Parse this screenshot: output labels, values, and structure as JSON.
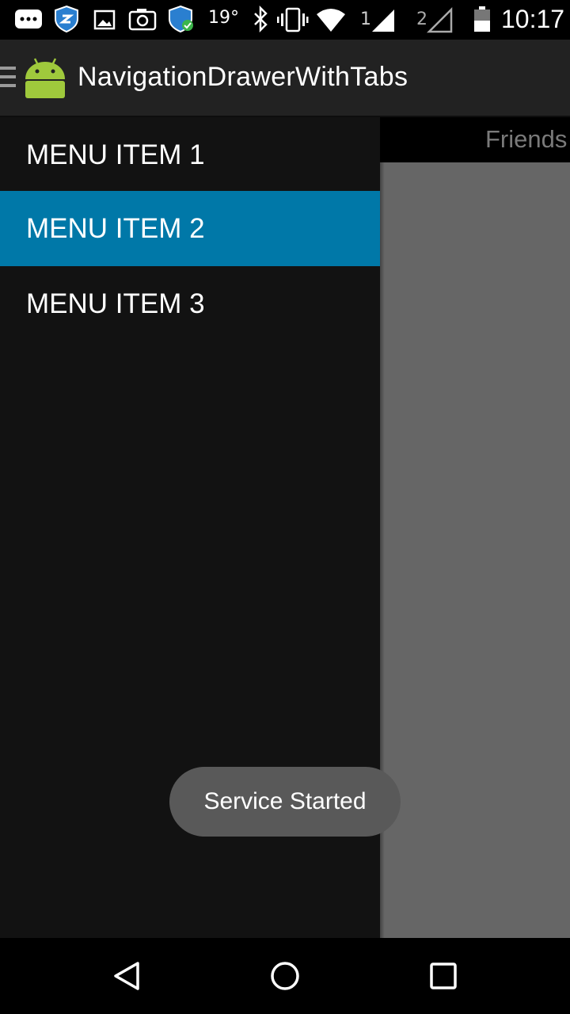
{
  "status_bar": {
    "temperature": "19°",
    "sim1": "1",
    "sim2": "2",
    "time": "10:17",
    "icons": [
      "messages-icon",
      "shield-icon",
      "image-icon",
      "camera-icon",
      "shield-check-icon",
      "bluetooth-icon",
      "vibrate-icon",
      "wifi-icon",
      "signal-icon",
      "signal-icon",
      "battery-icon"
    ]
  },
  "action_bar": {
    "title": "NavigationDrawerWithTabs",
    "icons": [
      "hamburger-icon",
      "android-app-icon"
    ]
  },
  "tabs": {
    "visible_label": "Friends"
  },
  "drawer": {
    "items": [
      {
        "label": "MENU ITEM 1",
        "selected": false
      },
      {
        "label": "MENU ITEM 2",
        "selected": true
      },
      {
        "label": "MENU ITEM 3",
        "selected": false
      }
    ],
    "selected_color": "#0078a8"
  },
  "toast": {
    "message": "Service Started"
  },
  "nav_bar": {
    "icons": [
      "back-icon",
      "home-icon",
      "recents-icon"
    ]
  }
}
